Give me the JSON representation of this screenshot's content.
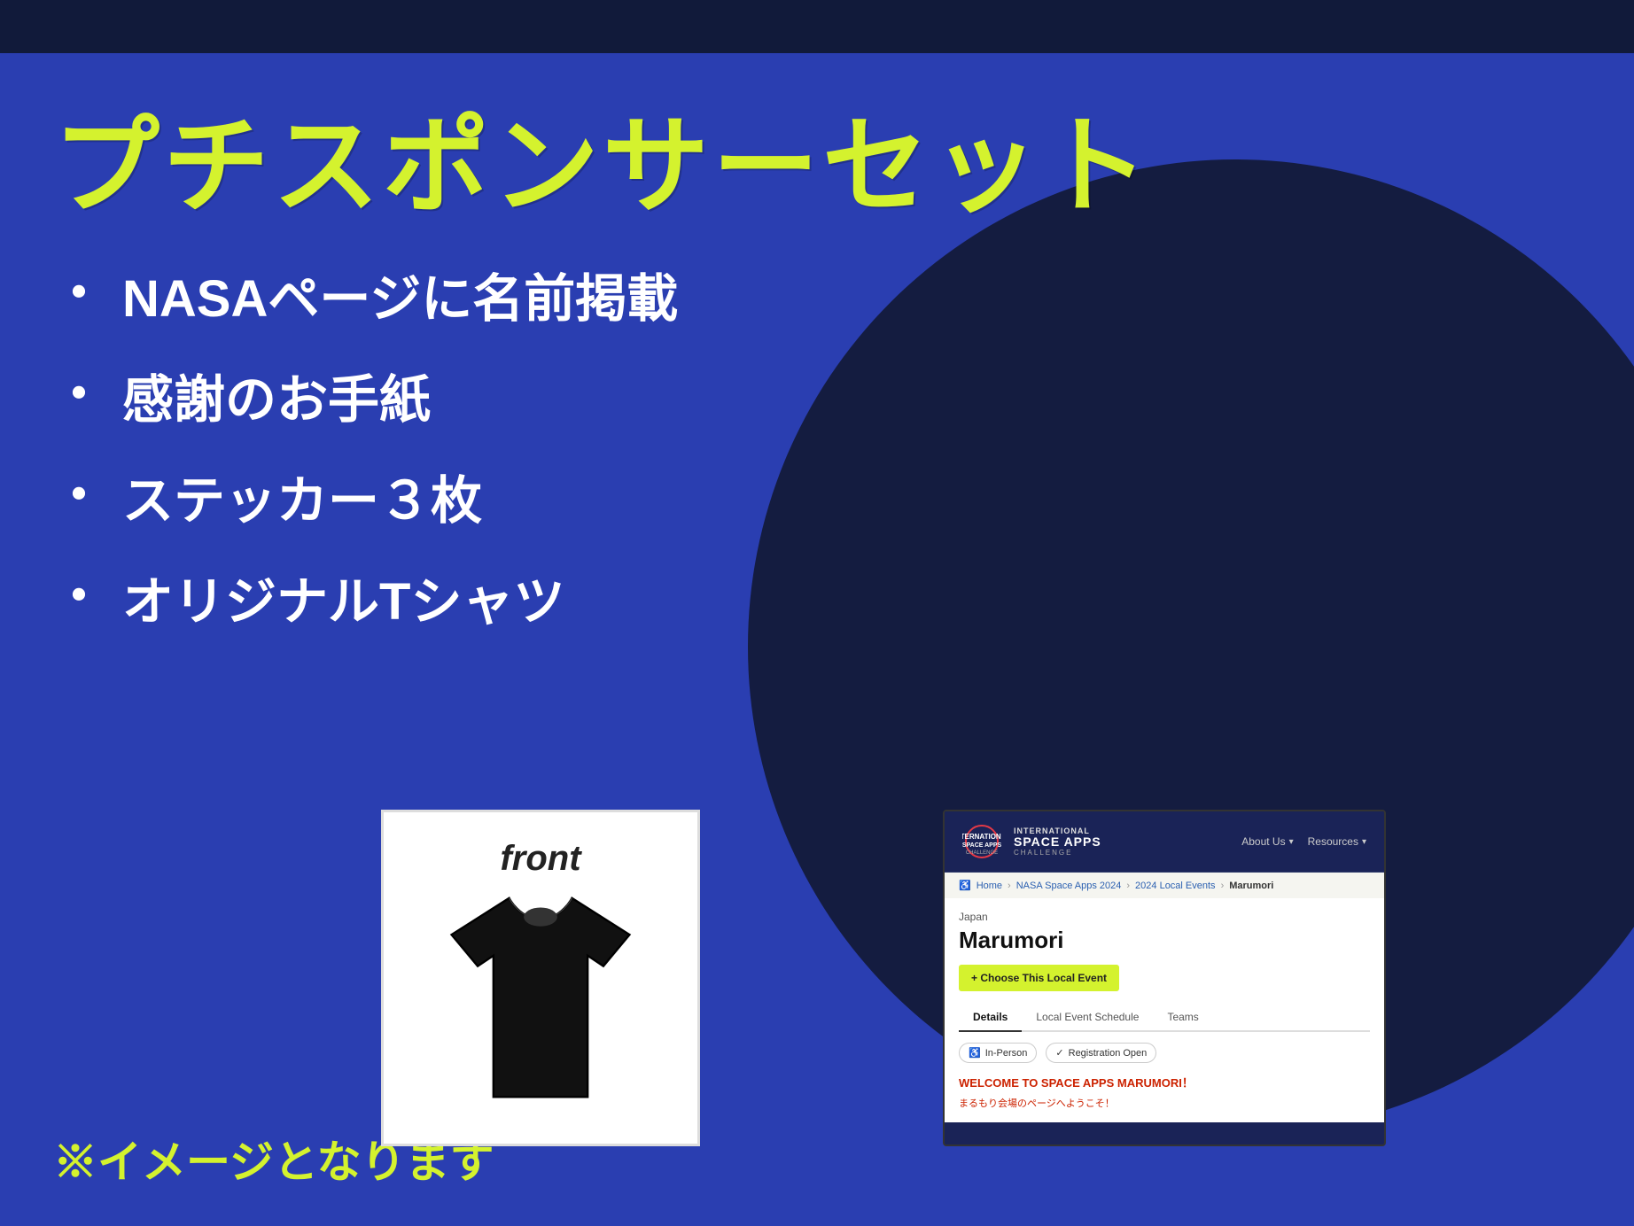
{
  "slide": {
    "top_bar_color": "#111a3a",
    "bg_color": "#2a3eb1",
    "circle_color": "#141c40"
  },
  "title": {
    "text": "プチスポンサーセット"
  },
  "bullets": [
    {
      "text": "NASAページに名前掲載"
    },
    {
      "text": "感謝のお手紙"
    },
    {
      "text": "ステッカー３枚"
    },
    {
      "text": "オリジナルTシャツ"
    }
  ],
  "bottom_note": "※イメージとなります",
  "tshirt": {
    "label": "front"
  },
  "website": {
    "logo_line1": "INTERNATIONAL",
    "logo_line2": "SPACE APPS",
    "logo_line3": "CHALLENGE",
    "nav_items": [
      "About Us",
      "Resources"
    ],
    "breadcrumb": [
      "Home",
      "NASA Space Apps 2024",
      "2024 Local Events",
      "Marumori"
    ],
    "country": "Japan",
    "city": "Marumori",
    "choose_btn": "+ Choose This Local Event",
    "tabs": [
      "Details",
      "Local Event Schedule",
      "Teams"
    ],
    "active_tab": "Details",
    "badges": [
      "In-Person",
      "Registration Open"
    ],
    "welcome_text": "WELCOME TO SPACE APPS MARUMORI！",
    "welcome_sub": "まるもり会場のページへようこそ！"
  }
}
